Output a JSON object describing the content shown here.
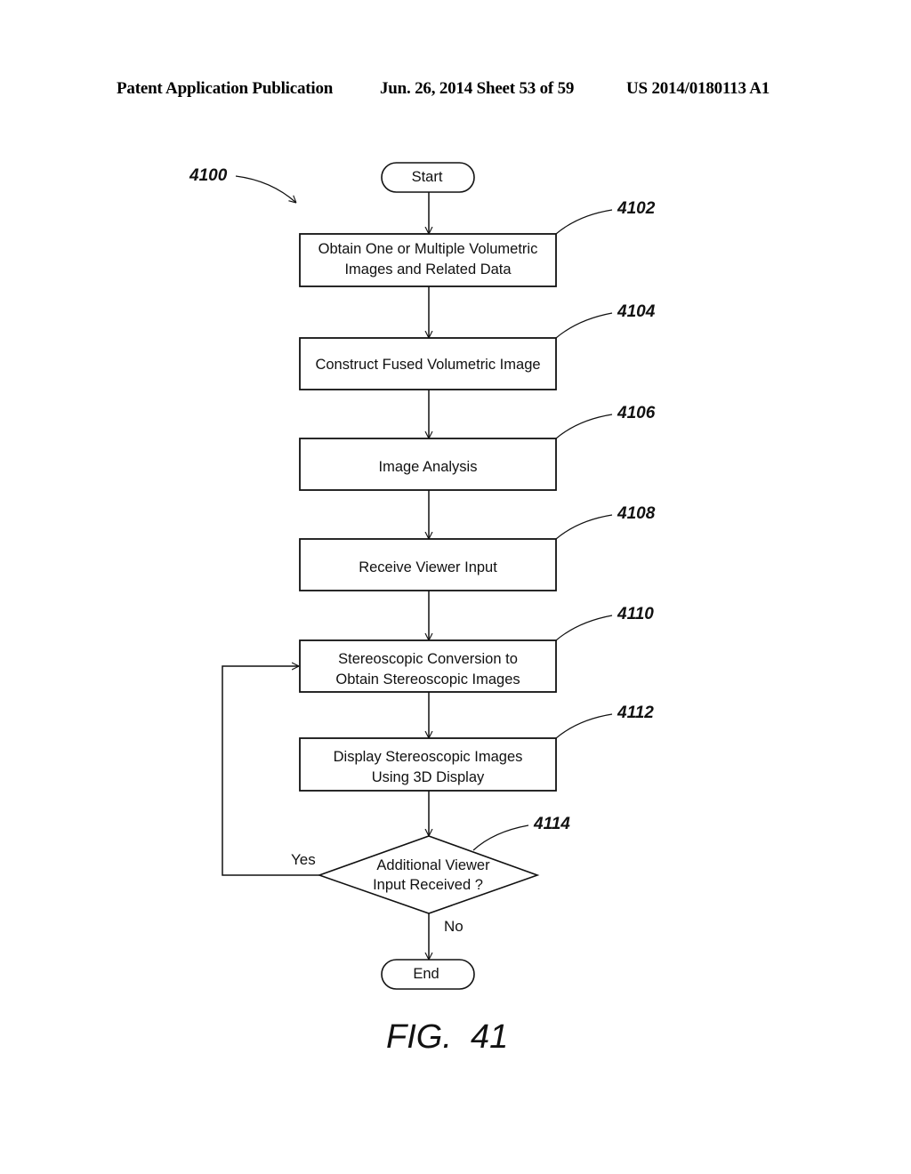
{
  "header": {
    "publication": "Patent Application Publication",
    "date_sheet": "Jun. 26, 2014  Sheet 53 of 59",
    "number": "US 2014/0180113 A1"
  },
  "diagram": {
    "ref_main": "4100",
    "start_label": "Start",
    "end_label": "End",
    "steps": [
      {
        "ref": "4102",
        "lines": [
          "Obtain One or Multiple Volumetric",
          "Images and Related Data"
        ]
      },
      {
        "ref": "4104",
        "lines": [
          "Construct Fused Volumetric Image"
        ]
      },
      {
        "ref": "4106",
        "lines": [
          "Image Analysis"
        ]
      },
      {
        "ref": "4108",
        "lines": [
          "Receive Viewer Input"
        ]
      },
      {
        "ref": "4110",
        "lines": [
          "Stereoscopic Conversion to",
          "Obtain Stereoscopic Images"
        ]
      },
      {
        "ref": "4112",
        "lines": [
          "Display Stereoscopic Images",
          "Using 3D Display"
        ]
      }
    ],
    "decision": {
      "ref": "4114",
      "lines": [
        "Additional Viewer",
        "Input Received ?"
      ],
      "yes_label": "Yes",
      "no_label": "No"
    },
    "figure_label": "FIG.  41"
  }
}
